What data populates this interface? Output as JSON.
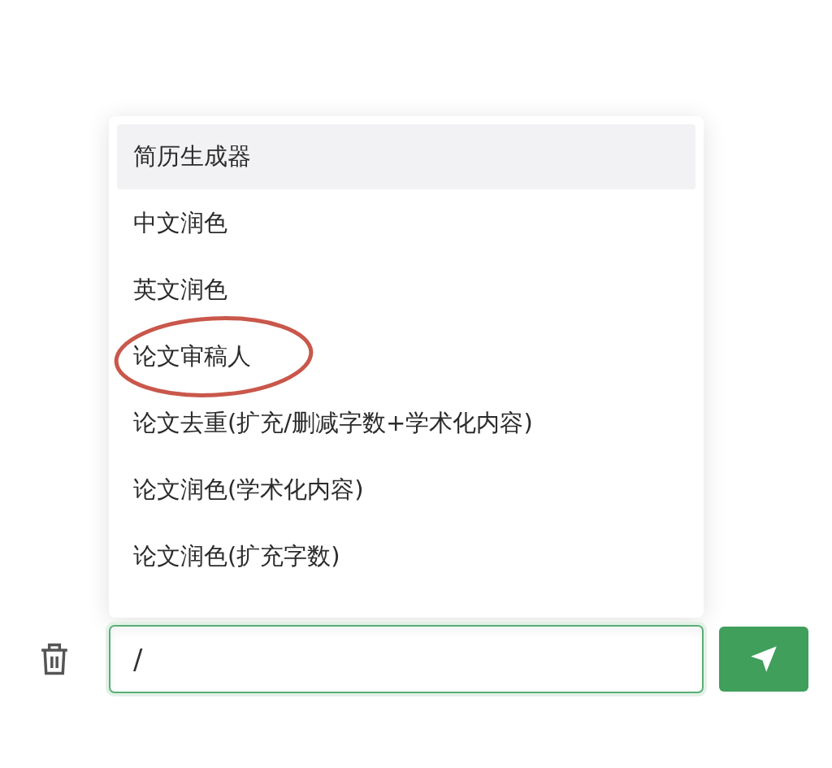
{
  "menu": {
    "items": [
      {
        "label": "简历生成器",
        "selected": true,
        "circled": false
      },
      {
        "label": "中文润色",
        "selected": false,
        "circled": false
      },
      {
        "label": "英文润色",
        "selected": false,
        "circled": false
      },
      {
        "label": "论文审稿人",
        "selected": false,
        "circled": true
      },
      {
        "label": "论文去重(扩充/删减字数+学术化内容)",
        "selected": false,
        "circled": false
      },
      {
        "label": "论文润色(学术化内容)",
        "selected": false,
        "circled": false
      },
      {
        "label": "论文润色(扩充字数)",
        "selected": false,
        "circled": false
      }
    ]
  },
  "input": {
    "value": "/"
  }
}
